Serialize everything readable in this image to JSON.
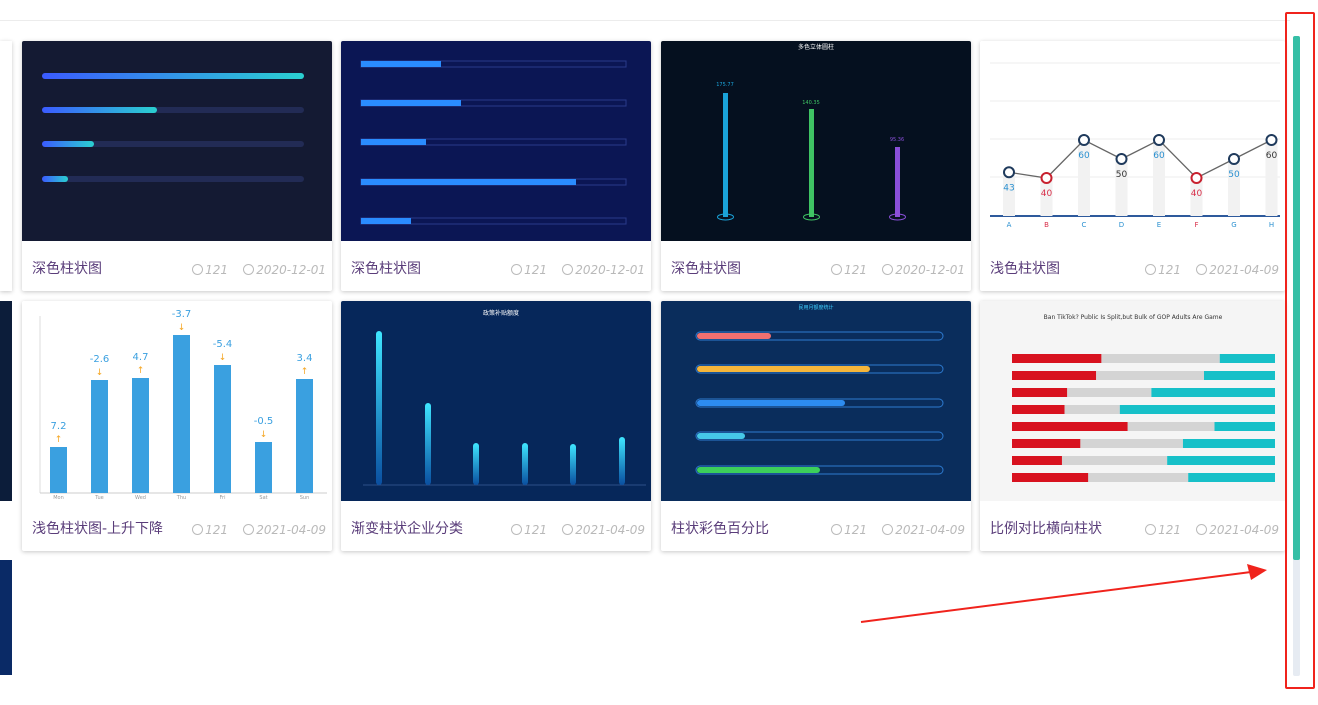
{
  "cards": [
    {
      "title": "深色柱状图",
      "views": "121",
      "date": "2020-12-01"
    },
    {
      "title": "深色柱状图",
      "views": "121",
      "date": "2020-12-01"
    },
    {
      "title": "深色柱状图",
      "views": "121",
      "date": "2020-12-01"
    },
    {
      "title": "浅色柱状图",
      "views": "121",
      "date": "2021-04-09"
    },
    {
      "title": "浅色柱状图-上升下降",
      "views": "121",
      "date": "2021-04-09"
    },
    {
      "title": "渐变柱状企业分类",
      "views": "121",
      "date": "2021-04-09"
    },
    {
      "title": "柱状彩色百分比",
      "views": "121",
      "date": "2021-04-09"
    },
    {
      "title": "比例对比横向柱状",
      "views": "121",
      "date": "2021-04-09"
    }
  ],
  "thumbs": {
    "dark3_title": "多色立体圆柱",
    "dark3_values": [
      "175.77",
      "140.35",
      "95.36"
    ],
    "light1_values": [
      43,
      40,
      60,
      50,
      60,
      40,
      50,
      60
    ],
    "light1_categories": [
      "A",
      "B",
      "C",
      "D",
      "E",
      "F",
      "G",
      "H"
    ],
    "light2_values": [
      "7.2",
      "-2.6",
      "4.7",
      "-3.7",
      "-5.4",
      "-0.5",
      "3.4"
    ],
    "light2_categories": [
      "Mon",
      "Tue",
      "Wed",
      "Thu",
      "Fri",
      "Sat",
      "Sun"
    ],
    "grad_title": "政策补贴额度",
    "pct_title": "民用月额度统计",
    "ratio_title": "Ban TikTok? Public Is Split,but Bulk of GOP Adults Are Game"
  },
  "colors": {
    "scroll_thumb": "#36bfa6",
    "annotation": "#f0231c",
    "title_text": "#5a3d7a"
  }
}
